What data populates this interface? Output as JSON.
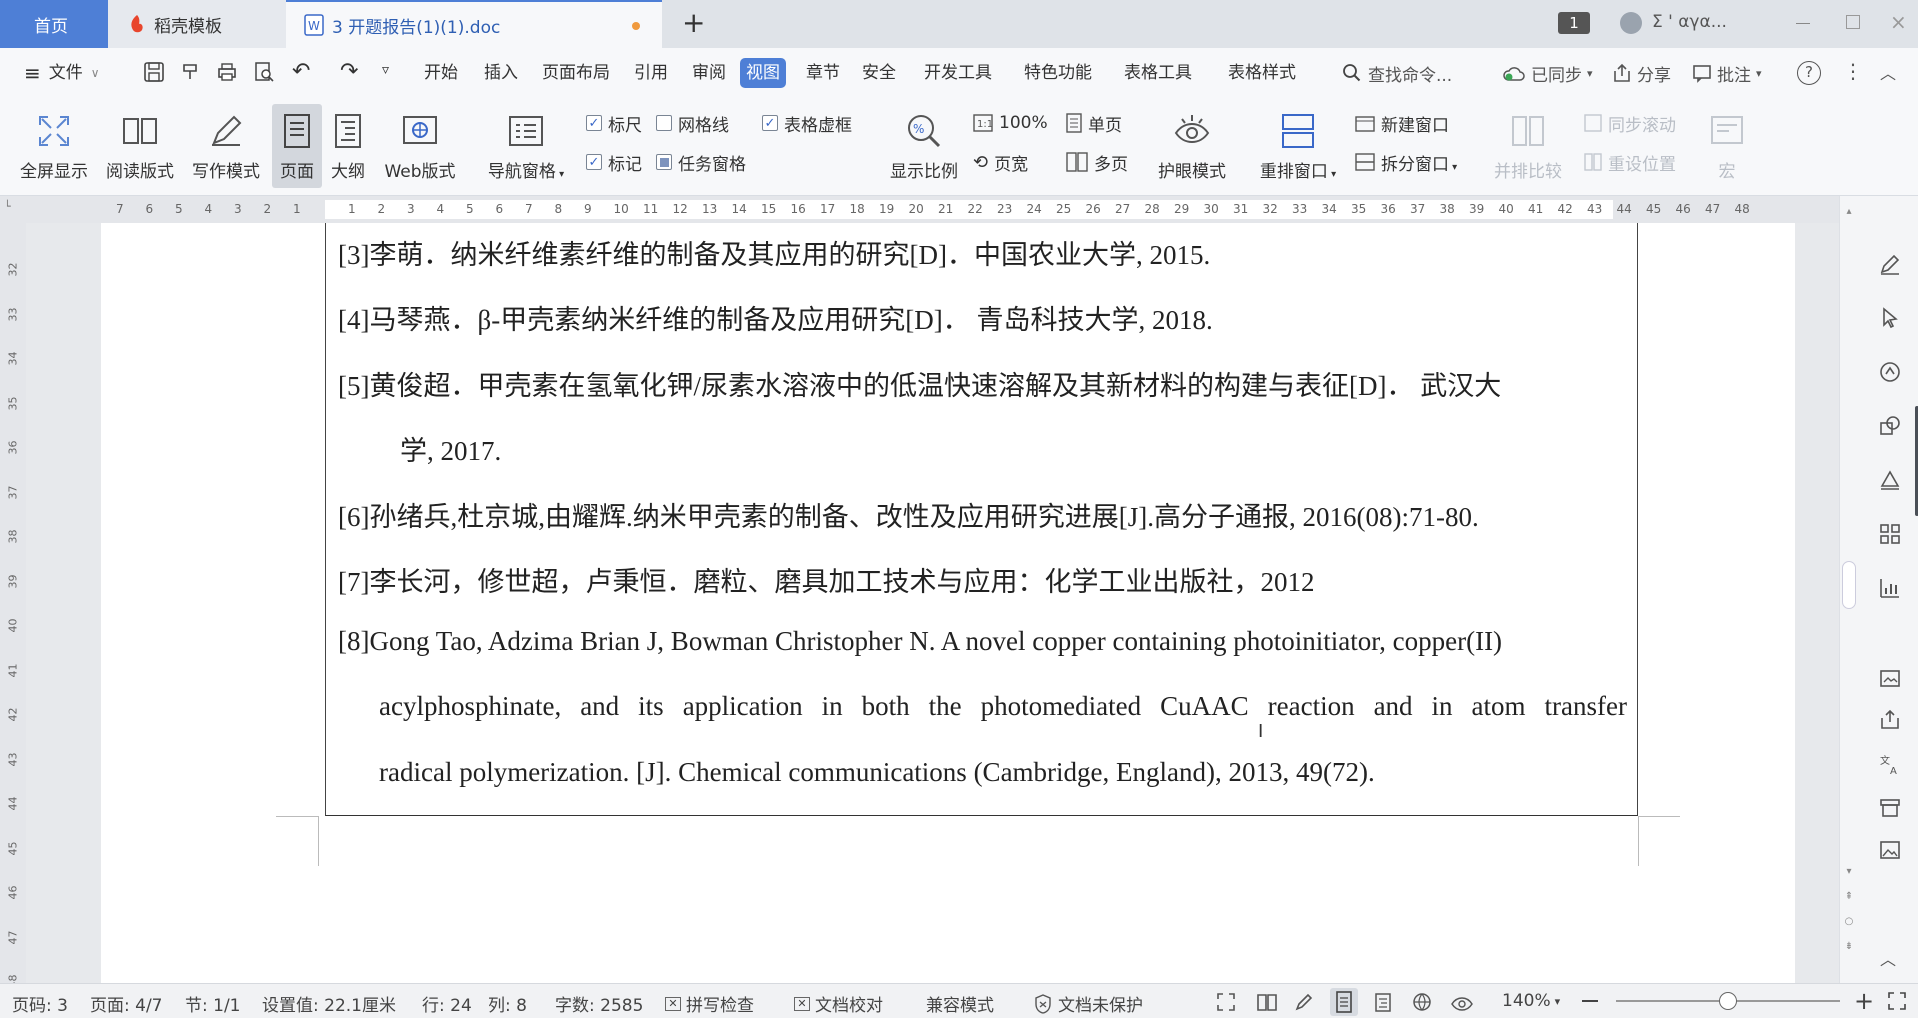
{
  "tabs": {
    "home": "首页",
    "docer": "稻壳模板",
    "doc": "3 开题报告(1)(1).doc",
    "add": "+"
  },
  "window": {
    "badge": "1",
    "user": "Σ ' αγα..."
  },
  "menu": {
    "file": "文件",
    "items": [
      "开始",
      "插入",
      "页面布局",
      "引用",
      "审阅",
      "视图",
      "章节",
      "安全",
      "开发工具",
      "特色功能",
      "表格工具",
      "表格样式"
    ],
    "active": "视图",
    "search": "查找命令...",
    "sync": "已同步",
    "share": "分享",
    "comment": "批注"
  },
  "ribbon": {
    "fullscreen": "全屏显示",
    "reading": "阅读版式",
    "writing": "写作模式",
    "page": "页面",
    "outline": "大纲",
    "web": "Web版式",
    "nav": "导航窗格",
    "ruler": "标尺",
    "grid": "网格线",
    "table_lines": "表格虚框",
    "mark": "标记",
    "task_pane": "任务窗格",
    "zoom": "显示比例",
    "zoom100": "100%",
    "page_width": "页宽",
    "single": "单页",
    "multi": "多页",
    "eye": "护眼模式",
    "rearrange": "重排窗口",
    "new_window": "新建窗口",
    "split": "拆分窗口",
    "side_by_side": "并排比较",
    "sync_scroll": "同步滚动",
    "reset_pos": "重设位置",
    "macro": "宏"
  },
  "ruler": {
    "left_ticks": [
      "7",
      "6",
      "5",
      "4",
      "3",
      "2",
      "1"
    ],
    "right_ticks": [
      "1",
      "2",
      "3",
      "4",
      "5",
      "6",
      "7",
      "8",
      "9",
      "10",
      "11",
      "12",
      "13",
      "14",
      "15",
      "16",
      "17",
      "18",
      "19",
      "20",
      "21",
      "22",
      "23",
      "24",
      "25",
      "26",
      "27",
      "28",
      "29",
      "30",
      "31",
      "32",
      "33",
      "34",
      "35",
      "36",
      "37",
      "38",
      "39",
      "40",
      "41",
      "42",
      "43",
      "44",
      "45",
      "46",
      "47",
      "48"
    ],
    "vticks": [
      "32",
      "33",
      "34",
      "35",
      "36",
      "37",
      "38",
      "39",
      "40",
      "41",
      "42",
      "43",
      "44",
      "45",
      "46",
      "47",
      "48"
    ]
  },
  "document": {
    "lines": [
      "[3]李萌．纳米纤维素纤维的制备及其应用的研究[D]．中国农业大学, 2015.",
      "[4]马琴燕．β-甲壳素纳米纤维的制备及应用研究[D]． 青岛科技大学, 2018.",
      "[5]黄俊超．甲壳素在氢氧化钾/尿素水溶液中的低温快速溶解及其新材料的构建与表征[D]． 武汉大",
      "学, 2017.",
      "[6]孙绪兵,杜京城,由耀辉.纳米甲壳素的制备、改性及应用研究进展[J].高分子通报, 2016(08):71-80.",
      "[7]李长河，修世超，卢秉恒．磨粒、磨具加工技术与应用：化学工业出版社，2012",
      "[8]Gong Tao, Adzima Brian J, Bowman Christopher N. A novel copper containing photoinitiator, copper(II)",
      "acylphosphinate, and its application in both the photomediated CuAAC reaction and in atom transfer",
      "radical polymerization. [J]. Chemical communications (Cambridge, England), 2013, 49(72)."
    ]
  },
  "status": {
    "page": "页码: 3",
    "pages": "页面: 4/7",
    "section": "节: 1/1",
    "setting": "设置值: 22.1厘米",
    "row": "行: 24",
    "col": "列: 8",
    "words": "字数: 2585",
    "spell": "拼写检查",
    "proof": "文档校对",
    "compat": "兼容模式",
    "protect": "文档未保护",
    "zoom": "140%"
  },
  "colors": {
    "accent": "#4e7fd6",
    "home_tab": "#4e7fd6"
  }
}
